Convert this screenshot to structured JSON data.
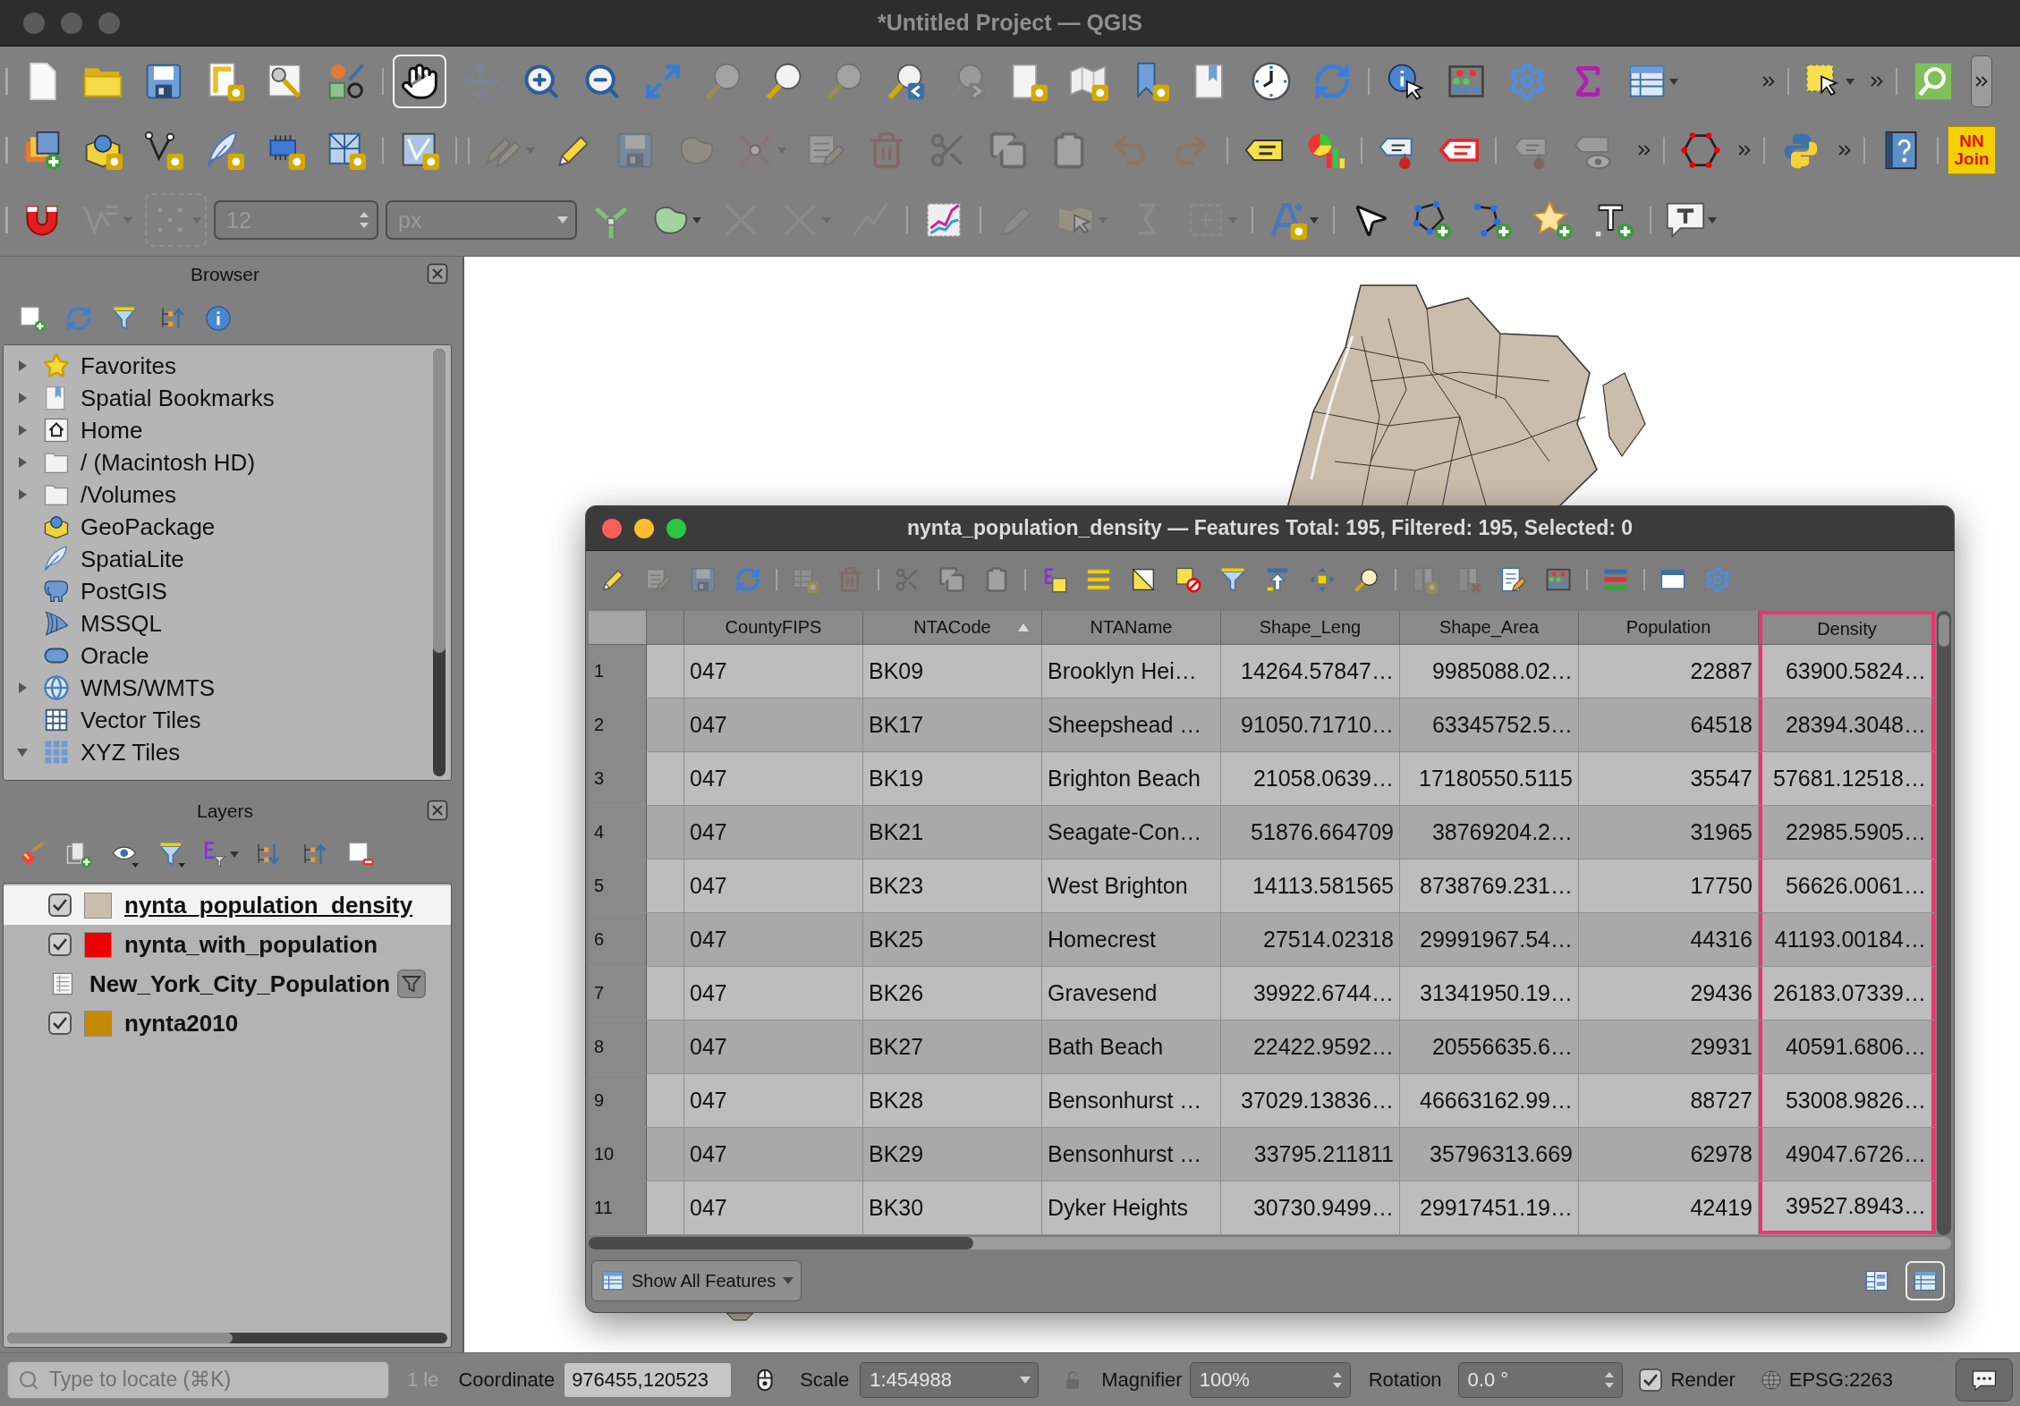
{
  "window": {
    "title": "*Untitled Project — QGIS",
    "focused": false
  },
  "toolbars": [
    {
      "buttons": [
        {
          "disabled": false,
          "active": false
        },
        {
          "disabled": false,
          "active": false
        },
        {
          "disabled": false,
          "active": false
        },
        {
          "disabled": false,
          "active": false
        },
        {
          "disabled": false,
          "active": false
        },
        {
          "disabled": false,
          "active": false
        },
        {
          "disabled": false,
          "active": true
        },
        {
          "disabled": true,
          "active": false
        },
        {
          "disabled": false,
          "active": false
        },
        {
          "disabled": false,
          "active": false
        },
        {
          "disabled": false,
          "active": false
        },
        {
          "disabled": true,
          "active": false
        },
        {
          "disabled": false,
          "active": false
        },
        {
          "disabled": true,
          "active": false
        },
        {
          "disabled": false,
          "active": false
        },
        {
          "disabled": true,
          "active": false
        },
        {
          "disabled": false,
          "active": false
        },
        {
          "disabled": false,
          "active": false
        },
        {
          "disabled": false,
          "active": false
        },
        {
          "disabled": false,
          "active": false
        },
        {
          "disabled": false,
          "active": false
        },
        {
          "disabled": false,
          "active": false
        },
        {
          "disabled": false,
          "active": false
        },
        {
          "disabled": false,
          "active": false
        },
        {
          "disabled": false,
          "active": false
        },
        {
          "disabled": false,
          "active": false
        },
        {
          "disabled": false,
          "active": false
        },
        {
          "disabled": false,
          "active": false
        },
        {
          "disabled": false,
          "active": false
        },
        {
          "disabled": false,
          "active": false
        },
        {
          "disabled": false,
          "active": false
        },
        {
          "disabled": false,
          "active": false
        }
      ]
    },
    {
      "buttons": [
        {
          "disabled": false,
          "active": false
        },
        {
          "disabled": false,
          "active": false
        },
        {
          "disabled": false,
          "active": false
        },
        {
          "disabled": false,
          "active": false
        },
        {
          "disabled": false,
          "active": false
        },
        {
          "disabled": false,
          "active": false
        },
        {
          "disabled": false,
          "active": false
        },
        {
          "disabled": true,
          "active": false
        },
        {
          "disabled": false,
          "active": false
        },
        {
          "disabled": true,
          "active": false
        },
        {
          "disabled": true,
          "active": false
        },
        {
          "disabled": true,
          "active": false
        },
        {
          "disabled": true,
          "active": false
        },
        {
          "disabled": true,
          "active": false
        },
        {
          "disabled": true,
          "active": false
        },
        {
          "disabled": true,
          "active": false
        },
        {
          "disabled": true,
          "active": false
        },
        {
          "disabled": true,
          "active": false
        },
        {
          "disabled": true,
          "active": false
        },
        {
          "disabled": false,
          "active": false
        },
        {
          "disabled": false,
          "active": false
        },
        {
          "disabled": false,
          "active": false
        },
        {
          "disabled": false,
          "active": false
        },
        {
          "disabled": true,
          "active": false
        },
        {
          "disabled": true,
          "active": false
        },
        {
          "disabled": false,
          "active": false
        },
        {
          "disabled": false,
          "active": false
        },
        {
          "disabled": false,
          "active": false
        },
        {
          "disabled": false,
          "active": false
        },
        {
          "disabled": false,
          "active": false
        },
        {
          "disabled": false,
          "active": false
        },
        {
          "disabled": false,
          "active": false,
          "label": "NN Join"
        }
      ]
    },
    {
      "buttons": [
        {
          "disabled": false,
          "active": false
        },
        {
          "disabled": true,
          "active": false
        },
        {
          "disabled": true,
          "active": false
        },
        {
          "disabled": false,
          "active": false
        },
        {
          "disabled": false,
          "active": false
        },
        {
          "disabled": true,
          "active": false
        },
        {
          "disabled": true,
          "active": false
        },
        {
          "disabled": true,
          "active": false
        },
        {
          "disabled": false,
          "active": false
        },
        {
          "disabled": true,
          "active": false
        },
        {
          "disabled": true,
          "active": false
        },
        {
          "disabled": true,
          "active": false
        },
        {
          "disabled": true,
          "active": false
        },
        {
          "disabled": false,
          "active": false
        },
        {
          "disabled": false,
          "active": false
        },
        {
          "disabled": false,
          "active": false
        },
        {
          "disabled": false,
          "active": false
        },
        {
          "disabled": false,
          "active": false
        },
        {
          "disabled": false,
          "active": false
        },
        {
          "disabled": false,
          "active": false
        }
      ]
    }
  ],
  "snapping": {
    "tolerance": "12",
    "units": "px",
    "disabled": true
  },
  "browser": {
    "title": "Browser",
    "items": [
      {
        "label": "Favorites",
        "kind": "favorites",
        "expanded": false
      },
      {
        "label": "Spatial Bookmarks",
        "kind": "bookmarks",
        "expanded": false
      },
      {
        "label": "Home",
        "kind": "home",
        "expanded": false
      },
      {
        "label": "/ (Macintosh HD)",
        "kind": "folder",
        "expanded": false
      },
      {
        "label": "/Volumes",
        "kind": "folder",
        "expanded": false
      },
      {
        "label": "GeoPackage",
        "kind": "geopackage"
      },
      {
        "label": "SpatiaLite",
        "kind": "spatialite"
      },
      {
        "label": "PostGIS",
        "kind": "postgis"
      },
      {
        "label": "MSSQL",
        "kind": "mssql"
      },
      {
        "label": "Oracle",
        "kind": "oracle"
      },
      {
        "label": "WMS/WMTS",
        "kind": "wms",
        "expanded": false
      },
      {
        "label": "Vector Tiles",
        "kind": "vector_tiles"
      },
      {
        "label": "XYZ Tiles",
        "kind": "xyz_tiles",
        "expanded": true
      }
    ]
  },
  "layers": {
    "title": "Layers",
    "items": [
      {
        "name": "nynta_population_density",
        "kind": "vector",
        "visible": true,
        "color": "#cbbdab",
        "selected": true,
        "filtered": false
      },
      {
        "name": "nynta_with_population",
        "kind": "vector",
        "visible": true,
        "color": "#ee0000",
        "selected": false,
        "filtered": false
      },
      {
        "name": "New_York_City_Population",
        "kind": "table",
        "selected": false,
        "filtered": true
      },
      {
        "name": "nynta2010",
        "kind": "vector",
        "visible": true,
        "color": "#c48a00",
        "selected": false,
        "filtered": false
      }
    ]
  },
  "attribute_table": {
    "title": "nynta_population_density — Features Total: 195, Filtered: 195, Selected: 0",
    "focused": true,
    "toolbar": [
      {
        "disabled": false
      },
      {
        "disabled": true
      },
      {
        "disabled": true
      },
      {
        "disabled": false
      },
      {
        "disabled": true
      },
      {
        "disabled": true
      },
      {
        "disabled": true
      },
      {
        "disabled": true
      },
      {
        "disabled": true
      },
      {
        "disabled": false
      },
      {
        "disabled": false
      },
      {
        "disabled": false
      },
      {
        "disabled": false
      },
      {
        "disabled": false
      },
      {
        "disabled": false
      },
      {
        "disabled": false
      },
      {
        "disabled": false
      },
      {
        "disabled": true
      },
      {
        "disabled": true
      },
      {
        "disabled": false
      },
      {
        "disabled": false
      },
      {
        "disabled": false
      },
      {
        "disabled": false
      },
      {
        "disabled": false
      }
    ],
    "columns": [
      {
        "label": "CountyFIPS",
        "kind": "text",
        "sorted": false,
        "highlighted": false
      },
      {
        "label": "NTACode",
        "kind": "text",
        "sorted": true,
        "highlighted": false
      },
      {
        "label": "NTAName",
        "kind": "text",
        "sorted": false,
        "highlighted": false
      },
      {
        "label": "Shape_Leng",
        "kind": "number",
        "sorted": false,
        "highlighted": false
      },
      {
        "label": "Shape_Area",
        "kind": "number",
        "sorted": false,
        "highlighted": false
      },
      {
        "label": "Population",
        "kind": "number",
        "sorted": false,
        "highlighted": false
      },
      {
        "label": "Density",
        "kind": "number",
        "sorted": false,
        "highlighted": true
      }
    ],
    "rows": [
      {
        "number": "1",
        "cells": [
          "047",
          "BK09",
          "Brooklyn Hei…",
          "14264.57847…",
          "9985088.02…",
          "22887",
          "63900.5824…"
        ]
      },
      {
        "number": "2",
        "cells": [
          "047",
          "BK17",
          "Sheepshead …",
          "91050.71710…",
          "63345752.5…",
          "64518",
          "28394.3048…"
        ]
      },
      {
        "number": "3",
        "cells": [
          "047",
          "BK19",
          "Brighton Beach",
          "21058.0639…",
          "17180550.5115",
          "35547",
          "57681.12518…"
        ]
      },
      {
        "number": "4",
        "cells": [
          "047",
          "BK21",
          "Seagate-Con…",
          "51876.664709",
          "38769204.2…",
          "31965",
          "22985.5905…"
        ]
      },
      {
        "number": "5",
        "cells": [
          "047",
          "BK23",
          "West Brighton",
          "14113.581565",
          "8738769.231…",
          "17750",
          "56626.0061…"
        ]
      },
      {
        "number": "6",
        "cells": [
          "047",
          "BK25",
          "Homecrest",
          "27514.02318",
          "29991967.54…",
          "44316",
          "41193.00184…"
        ]
      },
      {
        "number": "7",
        "cells": [
          "047",
          "BK26",
          "Gravesend",
          "39922.6744…",
          "31341950.19…",
          "29436",
          "26183.07339…"
        ]
      },
      {
        "number": "8",
        "cells": [
          "047",
          "BK27",
          "Bath Beach",
          "22422.9592…",
          "20556635.6…",
          "29931",
          "40591.6806…"
        ]
      },
      {
        "number": "9",
        "cells": [
          "047",
          "BK28",
          "Bensonhurst …",
          "37029.13836…",
          "46663162.99…",
          "88727",
          "53008.9826…"
        ]
      },
      {
        "number": "10",
        "cells": [
          "047",
          "BK29",
          "Bensonhurst …",
          "33795.211811",
          "35796313.669",
          "62978",
          "49047.6726…"
        ]
      },
      {
        "number": "11",
        "cells": [
          "047",
          "BK30",
          "Dyker Heights",
          "30730.9499…",
          "29917451.19…",
          "42419",
          "39527.8943…"
        ]
      }
    ],
    "filter_button": {
      "label": "Show All Features"
    },
    "view_buttons": [
      {
        "kind": "form",
        "selected": false
      },
      {
        "kind": "table",
        "selected": true
      }
    ]
  },
  "status_bar": {
    "locator": {
      "placeholder": "Type to locate (⌘K)"
    },
    "message": "1 le",
    "coordinate": {
      "label": "Coordinate",
      "value": "976455,120523"
    },
    "scale": {
      "label": "Scale",
      "value": "1:454988"
    },
    "magnifier": {
      "label": "Magnifier",
      "value": "100%"
    },
    "rotation": {
      "label": "Rotation",
      "value": "0.0 °"
    },
    "render": {
      "label": "Render",
      "checked": true
    },
    "crs": "EPSG:2263"
  }
}
